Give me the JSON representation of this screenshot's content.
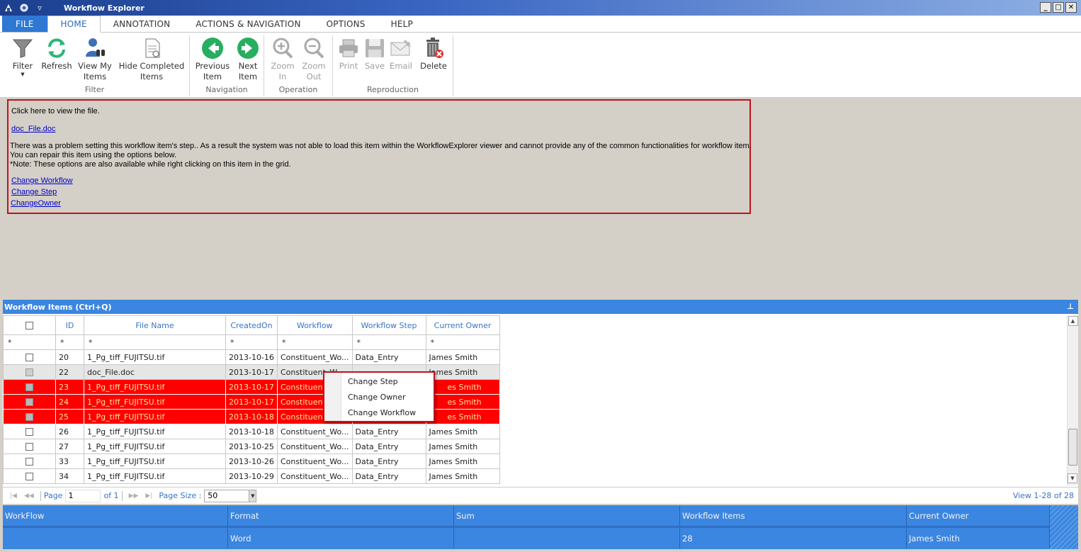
{
  "window": {
    "title": "Workflow Explorer",
    "buttons": [
      "_",
      "□",
      "✕"
    ]
  },
  "tabs": [
    {
      "label": "FILE"
    },
    {
      "label": "HOME"
    },
    {
      "label": "ANNOTATION"
    },
    {
      "label": "ACTIONS & NAVIGATION"
    },
    {
      "label": "OPTIONS"
    },
    {
      "label": "HELP"
    }
  ],
  "ribbon": {
    "filter_group": {
      "label": "Filter",
      "filter": {
        "line1": "Filter",
        "caret": "▼"
      },
      "refresh": {
        "line1": "Refresh"
      },
      "view_my_items": {
        "line1": "View My",
        "line2": "Items"
      },
      "hide_completed": {
        "line1": "Hide Completed",
        "line2": "Items"
      }
    },
    "navigation_group": {
      "label": "Navigation",
      "previous": {
        "line1": "Previous",
        "line2": "Item"
      },
      "next": {
        "line1": "Next",
        "line2": "Item"
      }
    },
    "operation_group": {
      "label": "Operation",
      "zoom_in": {
        "line1": "Zoom",
        "line2": "In"
      },
      "zoom_out": {
        "line1": "Zoom",
        "line2": "Out"
      }
    },
    "reproduction_group": {
      "label": "Reproduction",
      "print": {
        "line1": "Print"
      },
      "save": {
        "line1": "Save"
      },
      "email": {
        "line1": "Email"
      },
      "delete": {
        "line1": "Delete"
      }
    }
  },
  "viewer": {
    "click_here": "Click here to view the file.",
    "file_link": "doc_File.doc",
    "error_line1": "There was a problem setting this workflow item's step..  As a result the system was not able to load this item within the WorkflowExplorer viewer and cannot  provide any of the common functionalities for workflow item.",
    "error_line2": "You can repair this item using the options below.",
    "error_line3": "*Note: These options are also available while right clicking on this item in the grid.",
    "links": [
      "Change Workflow",
      "Change Step",
      "ChangeOwner"
    ]
  },
  "workflow_panel": {
    "title": "Workflow Items (Ctrl+Q)",
    "pin_icon": "⊥"
  },
  "grid": {
    "columns": [
      "ID",
      "File Name",
      "CreatedOn",
      "Workflow",
      "Workflow Step",
      "Current Owner"
    ],
    "filter_symbol": "*",
    "rows": [
      {
        "id": "20",
        "file": "1_Pg_tiff_FUJITSU.tif",
        "created": "2013-10-16",
        "workflow": "Constituent_Wo...",
        "step": "Data_Entry",
        "owner": "James Smith",
        "state": "normal"
      },
      {
        "id": "22",
        "file": "doc_File.doc",
        "created": "2013-10-17",
        "workflow": "Constituent_W",
        "step": "",
        "owner": "James Smith",
        "state": "selected"
      },
      {
        "id": "23",
        "file": "1_Pg_tiff_FUJITSU.tif",
        "created": "2013-10-17",
        "workflow": "Constituent_",
        "step": "",
        "owner": "es Smith",
        "state": "error"
      },
      {
        "id": "24",
        "file": "1_Pg_tiff_FUJITSU.tif",
        "created": "2013-10-17",
        "workflow": "Constituent_",
        "step": "",
        "owner": "es Smith",
        "state": "error"
      },
      {
        "id": "25",
        "file": "1_Pg_tiff_FUJITSU.tif",
        "created": "2013-10-18",
        "workflow": "Constituent_",
        "step": "",
        "owner": "es Smith",
        "state": "error"
      },
      {
        "id": "26",
        "file": "1_Pg_tiff_FUJITSU.tif",
        "created": "2013-10-18",
        "workflow": "Constituent_Wo...",
        "step": "Data_Entry",
        "owner": "James Smith",
        "state": "normal"
      },
      {
        "id": "27",
        "file": "1_Pg_tiff_FUJITSU.tif",
        "created": "2013-10-25",
        "workflow": "Constituent_Wo...",
        "step": "Data_Entry",
        "owner": "James Smith",
        "state": "normal"
      },
      {
        "id": "33",
        "file": "1_Pg_tiff_FUJITSU.tif",
        "created": "2013-10-26",
        "workflow": "Constituent_Wo...",
        "step": "Data_Entry",
        "owner": "James Smith",
        "state": "normal"
      },
      {
        "id": "34",
        "file": "1_Pg_tiff_FUJITSU.tif",
        "created": "2013-10-29",
        "workflow": "Constituent_Wo...",
        "step": "Data_Entry",
        "owner": "James Smith",
        "state": "normal"
      }
    ]
  },
  "context_menu": {
    "items": [
      "Change Step",
      "Change Owner",
      "Change Workflow"
    ]
  },
  "pager": {
    "page_label": "Page",
    "page_value": "1",
    "of_label": "of 1",
    "page_size_label": "Page Size :",
    "page_size_value": "50",
    "view_info": "View 1-28 of 28"
  },
  "summary": {
    "headers": [
      "WorkFlow",
      "Format",
      "Sum",
      "Workflow Items",
      "Current Owner"
    ],
    "values": [
      "",
      "Word",
      "",
      "28",
      "James Smith"
    ]
  },
  "colors": {
    "accent": "#3b86e0",
    "error_row": "#fe0000",
    "error_border": "#c0121d",
    "link": "#0000cc"
  }
}
